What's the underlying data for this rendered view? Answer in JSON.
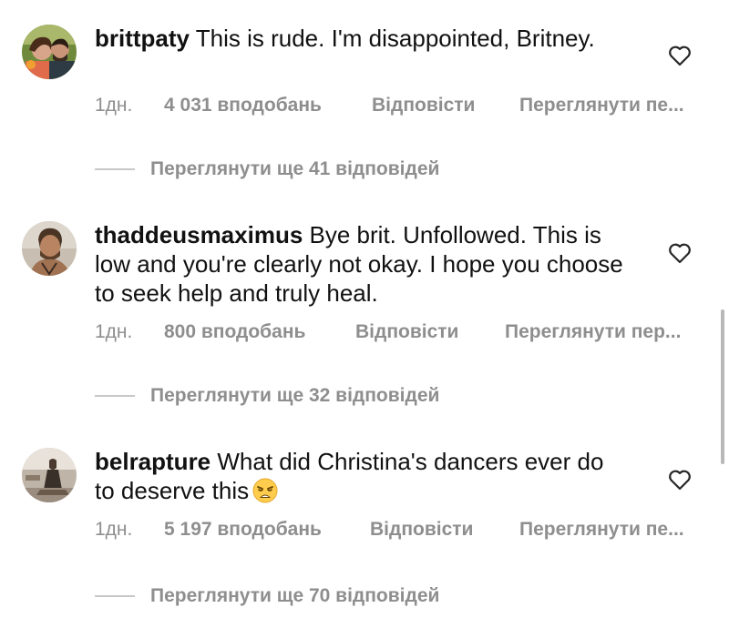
{
  "comments": [
    {
      "username": "brittpaty",
      "text": "This is rude. I'm disappointed, Britney.",
      "time": "1дн.",
      "likes": "4 031 вподобань",
      "reply_label": "Відповісти",
      "translate_label": "Переглянути пе...",
      "view_replies": "Переглянути ще 41 відповідей",
      "avatar_icon": "profile-photo-icon",
      "like_icon": "heart-outline-icon"
    },
    {
      "username": "thaddeusmaximus",
      "text": "Bye brit. Unfollowed. This is low and you're clearly not okay. I hope you choose to seek help and truly heal.",
      "time": "1дн.",
      "likes": "800 вподобань",
      "reply_label": "Відповісти",
      "translate_label": "Переглянути пер...",
      "view_replies": "Переглянути ще 32 відповідей",
      "avatar_icon": "profile-photo-icon",
      "like_icon": "heart-outline-icon"
    },
    {
      "username": "belrapture",
      "text": "What did Christina's dancers ever do to deserve this",
      "emoji_icon": "weary-face-emoji-icon",
      "time": "1дн.",
      "likes": "5 197 вподобань",
      "reply_label": "Відповісти",
      "translate_label": "Переглянути пе...",
      "view_replies": "Переглянути ще 70 відповідей",
      "avatar_icon": "profile-photo-icon",
      "like_icon": "heart-outline-icon"
    }
  ],
  "colors": {
    "text": "#111111",
    "secondary": "#8e8e8e",
    "divider": "#c7c7c7",
    "background": "#ffffff"
  }
}
